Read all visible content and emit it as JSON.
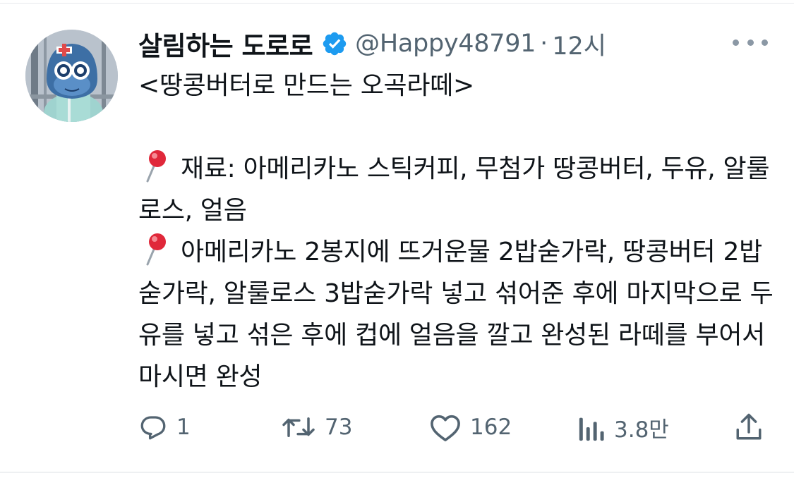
{
  "author": {
    "name": "살림하는 도로로",
    "handle": "@Happy48791",
    "separator": "·",
    "time": "12시",
    "verified": true
  },
  "tweet": {
    "title": "<땅콩버터로 만드는 오곡라떼>",
    "ingredients": "재료: 아메리카노 스틱커피, 무첨가 땅콩버터, 두유, 알룰로스, 얼음",
    "steps": "아메리카노 2봉지에 뜨거운물 2밥숟가락, 땅콩버터 2밥숟가락, 알룰로스 3밥숟가락 넣고 섞어준 후에 마지막으로 두유를 넣고 섞은 후에 컵에 얼음을 깔고 완성된 라떼를 부어서 마시면 완성"
  },
  "actions": {
    "replies": "1",
    "retweets": "73",
    "likes": "162",
    "views": "3.8만"
  },
  "icons": {
    "verified": "verified-badge-icon",
    "more": "more-options-icon",
    "pin": "round-pushpin-emoji",
    "reply": "reply-icon",
    "retweet": "retweet-icon",
    "like": "heart-icon",
    "views": "views-chart-icon",
    "share": "share-icon"
  },
  "colors": {
    "verified": "#1d9bf0",
    "text": "#0f1419",
    "muted": "#536471",
    "pin": "#e0283a"
  }
}
